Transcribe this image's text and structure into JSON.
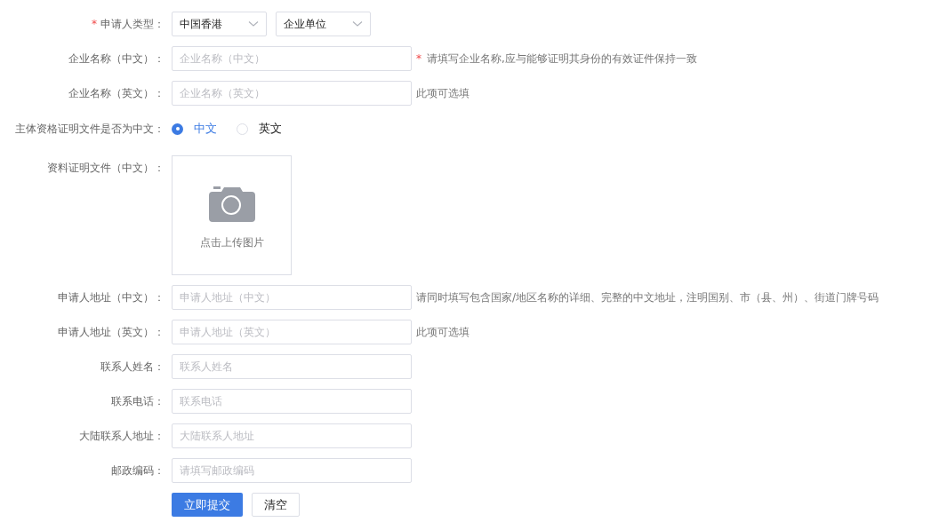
{
  "fields": [
    {
      "kind": "selects",
      "mark": "*",
      "label": "申请人类型：",
      "selects": [
        {
          "value": "中国香港"
        },
        {
          "value": "企业单位"
        }
      ]
    },
    {
      "kind": "text",
      "label": "企业名称（中文）：",
      "placeholder": "企业名称（中文）",
      "hint_mark": "*",
      "hint": "请填写企业名称,应与能够证明其身份的有效证件保持一致"
    },
    {
      "kind": "text",
      "label": "企业名称（英文）：",
      "placeholder": "企业名称（英文）",
      "hint": "此项可选填"
    },
    {
      "kind": "radio",
      "label": "主体资格证明文件是否为中文：",
      "options": [
        {
          "label": "中文",
          "selected": true
        },
        {
          "label": "英文",
          "selected": false
        }
      ]
    },
    {
      "kind": "upload",
      "label": "资料证明文件（中文）：",
      "text": "点击上传图片"
    },
    {
      "kind": "text",
      "label": "申请人地址（中文）：",
      "placeholder": "申请人地址（中文）",
      "hint": "请同时填写包含国家/地区名称的详细、完整的中文地址，注明国别、市（县、州）、街道门牌号码"
    },
    {
      "kind": "text",
      "label": "申请人地址（英文）：",
      "placeholder": "申请人地址（英文）",
      "hint": "此项可选填"
    },
    {
      "kind": "text",
      "label": "联系人姓名：",
      "placeholder": "联系人姓名"
    },
    {
      "kind": "text",
      "label": "联系电话：",
      "placeholder": "联系电话"
    },
    {
      "kind": "text",
      "label": "大陆联系人地址：",
      "placeholder": "大陆联系人地址"
    },
    {
      "kind": "text",
      "label": "邮政编码：",
      "placeholder": "请填写邮政编码"
    }
  ],
  "buttons": [
    {
      "kind": "primary",
      "label": "立即提交"
    },
    {
      "kind": "default",
      "label": "清空"
    }
  ]
}
